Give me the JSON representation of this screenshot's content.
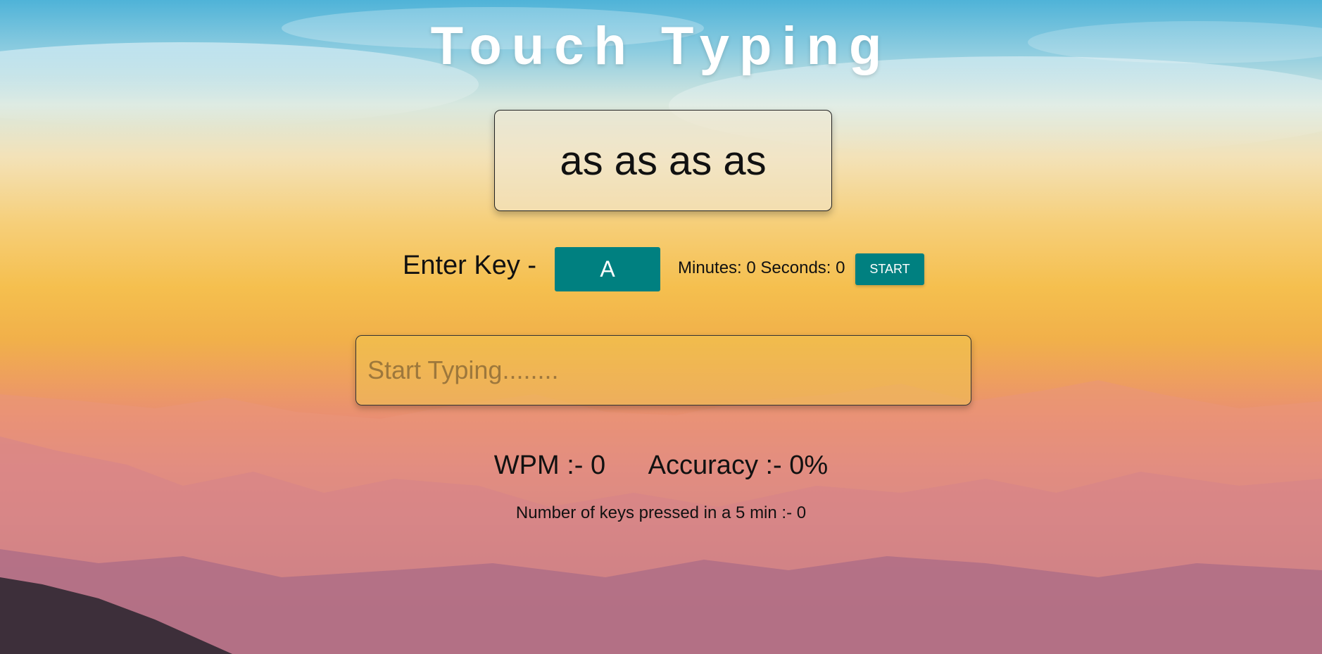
{
  "app": {
    "title": "Touch Typing"
  },
  "prompt": {
    "text": "as as as as"
  },
  "controls": {
    "enter_key_label": "Enter Key -",
    "current_key": "A",
    "timer_text": "Minutes: 0 Seconds: 0",
    "start_label": "START"
  },
  "input": {
    "placeholder": "Start Typing........",
    "value": ""
  },
  "stats": {
    "wpm_text": "WPM :- 0",
    "accuracy_text": "Accuracy :- 0%",
    "keys_pressed_text": "Number of keys pressed in a 5 min :- 0"
  },
  "colors": {
    "accent": "#008080",
    "title_text": "#ffffff"
  }
}
